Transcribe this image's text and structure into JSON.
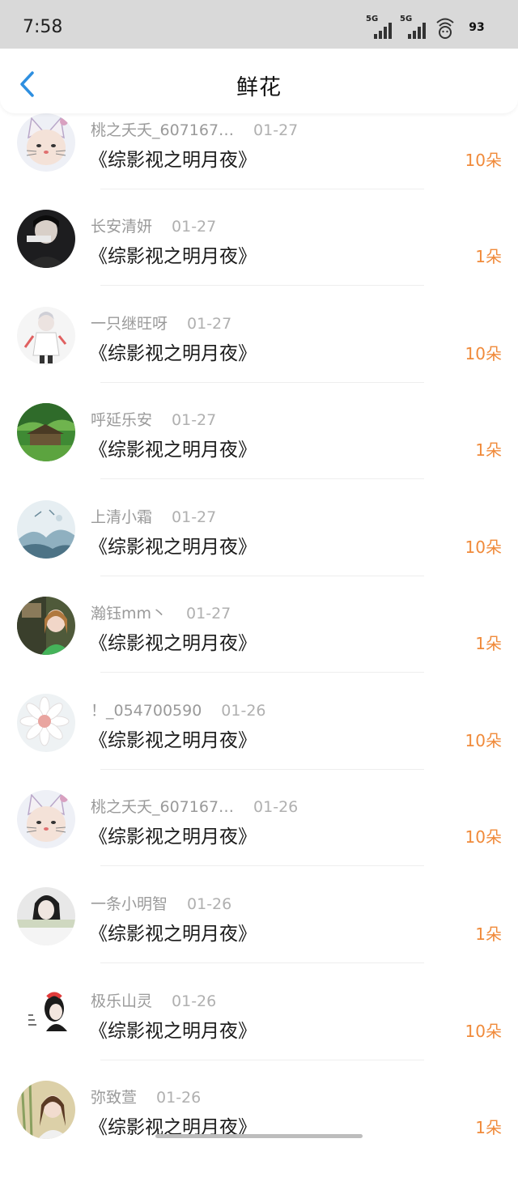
{
  "status": {
    "time": "7:58",
    "sim1": "5G",
    "sim2": "5G",
    "battery": "93"
  },
  "header": {
    "title": "鲜花"
  },
  "items": [
    {
      "user": "桃之夭夭_607167…",
      "date": "01-27",
      "book": "《综影视之明月夜》",
      "count": "10朵",
      "avatar": "cat-avatar"
    },
    {
      "user": "长安清妍",
      "date": "01-27",
      "book": "《综影视之明月夜》",
      "count": "1朵",
      "avatar": "dark-portrait-avatar"
    },
    {
      "user": "一只继旺呀",
      "date": "01-27",
      "book": "《综影视之明月夜》",
      "count": "10朵",
      "avatar": "anime-avatar"
    },
    {
      "user": "呼延乐安",
      "date": "01-27",
      "book": "《综影视之明月夜》",
      "count": "1朵",
      "avatar": "forest-house-avatar"
    },
    {
      "user": "上清小霜",
      "date": "01-27",
      "book": "《综影视之明月夜》",
      "count": "10朵",
      "avatar": "ink-landscape-avatar"
    },
    {
      "user": "瀚钰mm丶",
      "date": "01-27",
      "book": "《综影视之明月夜》",
      "count": "1朵",
      "avatar": "girl-photo-avatar"
    },
    {
      "user": "！_054700590",
      "date": "01-26",
      "book": "《综影视之明月夜》",
      "count": "10朵",
      "avatar": "flower-avatar"
    },
    {
      "user": "桃之夭夭_607167…",
      "date": "01-26",
      "book": "《综影视之明月夜》",
      "count": "10朵",
      "avatar": "cat-avatar"
    },
    {
      "user": "一条小明智",
      "date": "01-26",
      "book": "《综影视之明月夜》",
      "count": "1朵",
      "avatar": "bw-portrait-avatar"
    },
    {
      "user": "极乐山灵",
      "date": "01-26",
      "book": "《综影视之明月夜》",
      "count": "10朵",
      "avatar": "love-sketch-avatar"
    },
    {
      "user": "弥致萱",
      "date": "01-26",
      "book": "《综影视之明月夜》",
      "count": "1朵",
      "avatar": "girl-bamboo-avatar"
    }
  ],
  "colors": {
    "accent": "#f08a3a",
    "back": "#2e8fe0",
    "statusbar": "#d9d9d9"
  }
}
